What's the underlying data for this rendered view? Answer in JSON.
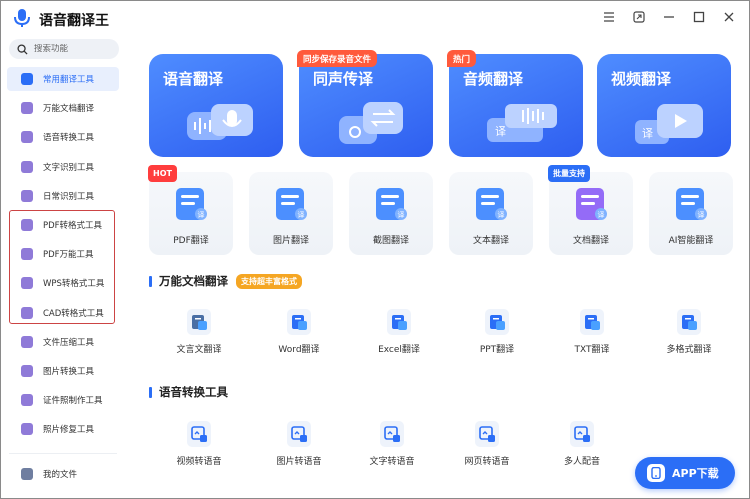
{
  "app": {
    "title": "语音翻译王"
  },
  "window_controls": [
    "menu-icon",
    "pin-icon",
    "minimize-icon",
    "maximize-icon",
    "close-icon"
  ],
  "search": {
    "placeholder": "搜索功能"
  },
  "sidebar": {
    "items": [
      {
        "label": "常用翻译工具",
        "icon": "translate-icon",
        "color": "#2b6ef6",
        "active": true
      },
      {
        "label": "万能文档翻译",
        "icon": "doc-icon",
        "color": "#8f7ad8"
      },
      {
        "label": "语音转换工具",
        "icon": "voice-icon",
        "color": "#8f7ad8"
      },
      {
        "label": "文字识别工具",
        "icon": "ocr-icon",
        "color": "#8f7ad8"
      },
      {
        "label": "日常识别工具",
        "icon": "scan-icon",
        "color": "#8f7ad8"
      },
      {
        "label": "PDF转格式工具",
        "icon": "pdf-icon",
        "color": "#8f7ad8"
      },
      {
        "label": "PDF万能工具",
        "icon": "pdf-tool-icon",
        "color": "#8f7ad8"
      },
      {
        "label": "WPS转格式工具",
        "icon": "wps-icon",
        "color": "#8f7ad8"
      },
      {
        "label": "CAD转格式工具",
        "icon": "cad-icon",
        "color": "#8f7ad8"
      },
      {
        "label": "文件压缩工具",
        "icon": "zip-icon",
        "color": "#8f7ad8"
      },
      {
        "label": "图片转换工具",
        "icon": "image-icon",
        "color": "#8f7ad8"
      },
      {
        "label": "证件照制作工具",
        "icon": "id-photo-icon",
        "color": "#8f7ad8"
      },
      {
        "label": "照片修复工具",
        "icon": "photo-fix-icon",
        "color": "#8f7ad8"
      }
    ],
    "footer": {
      "label": "我的文件",
      "icon": "folder-icon"
    }
  },
  "hero_cards": [
    {
      "title": "语音翻译",
      "badge": "",
      "color_a": "#4f8dff",
      "color_b": "#2e5ef0"
    },
    {
      "title": "同声传译",
      "badge": "同步保存录音文件",
      "color_a": "#4f8dff",
      "color_b": "#2e5ef0"
    },
    {
      "title": "音频翻译",
      "badge": "热门",
      "color_a": "#4f8dff",
      "color_b": "#2e5ef0"
    },
    {
      "title": "视频翻译",
      "badge": "",
      "color_a": "#4f8dff",
      "color_b": "#2e5ef0"
    }
  ],
  "tool_cards": [
    {
      "label": "PDF翻译",
      "badge": "HOT",
      "badge_color": "#ff3d3d",
      "icon": "pdf-icon"
    },
    {
      "label": "图片翻译",
      "badge": "",
      "icon": "image-translate-icon"
    },
    {
      "label": "截图翻译",
      "badge": "",
      "icon": "screenshot-icon"
    },
    {
      "label": "文本翻译",
      "badge": "",
      "icon": "text-icon"
    },
    {
      "label": "文档翻译",
      "badge": "批量支持",
      "badge_color": "#2b6ef6",
      "icon": "document-icon"
    },
    {
      "label": "AI智能翻译",
      "badge": "",
      "icon": "ai-robot-icon"
    }
  ],
  "section_doc": {
    "title": "万能文档翻译",
    "tag": "支持超丰富格式",
    "items": [
      {
        "label": "文言文翻译",
        "icon": "classical-icon",
        "color": "#4a6fa5"
      },
      {
        "label": "Word翻译",
        "icon": "word-icon",
        "color": "#2b6ef6"
      },
      {
        "label": "Excel翻译",
        "icon": "excel-icon",
        "color": "#2b6ef6"
      },
      {
        "label": "PPT翻译",
        "icon": "ppt-icon",
        "color": "#2b6ef6"
      },
      {
        "label": "TXT翻译",
        "icon": "txt-icon",
        "color": "#2b6ef6"
      },
      {
        "label": "多格式翻译",
        "icon": "multi-format-icon",
        "color": "#2b6ef6"
      }
    ]
  },
  "section_voice": {
    "title": "语音转换工具",
    "items": [
      {
        "label": "视频转语音",
        "icon": "video-to-audio-icon"
      },
      {
        "label": "图片转语音",
        "icon": "image-to-audio-icon"
      },
      {
        "label": "文字转语音",
        "icon": "text-to-audio-icon"
      },
      {
        "label": "网页转语音",
        "icon": "web-to-audio-icon"
      },
      {
        "label": "多人配音",
        "icon": "multi-dub-icon"
      }
    ]
  },
  "app_download": {
    "label": "APP下载"
  }
}
